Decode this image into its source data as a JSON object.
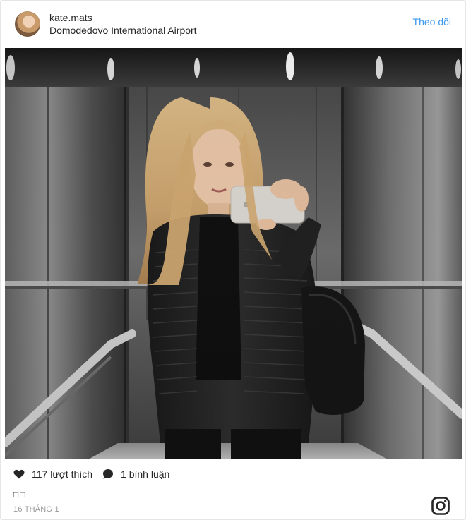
{
  "post": {
    "username": "kate.mats",
    "location": "Domodedovo International Airport",
    "follow_label": "Theo dõi",
    "likes_label": "117 lượt thích",
    "comments_label": "1 bình luận",
    "caption": "□□",
    "date": "16 THÁNG 1"
  },
  "icons": {
    "like": "heart-icon",
    "comment": "comment-bubble-icon",
    "brand": "instagram-icon"
  },
  "colors": {
    "accent": "#3897f0",
    "text": "#262626",
    "muted": "#999999"
  }
}
